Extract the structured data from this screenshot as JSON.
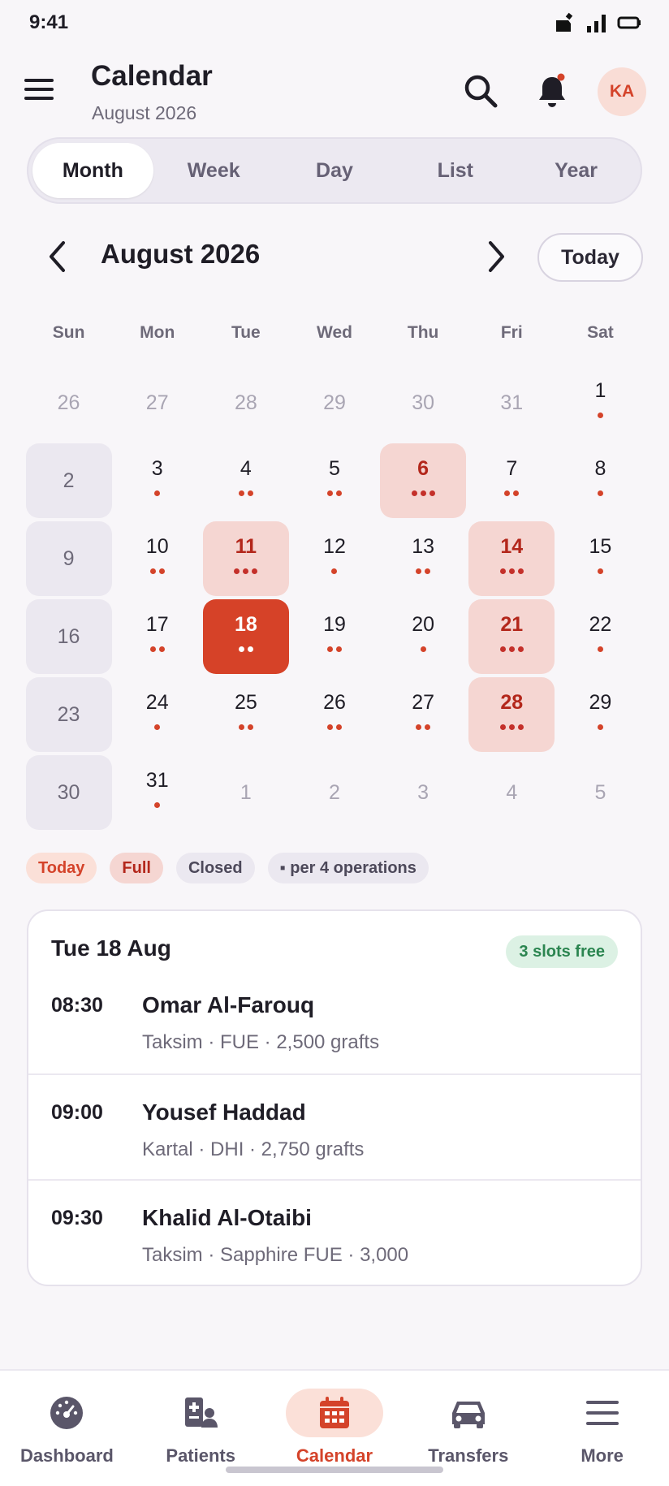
{
  "status_bar": {
    "time": "9:41"
  },
  "header": {
    "title": "Calendar",
    "subtitle": "August 2026",
    "avatar_initials": "KA"
  },
  "view_tabs": [
    {
      "label": "Month",
      "active": true
    },
    {
      "label": "Week",
      "active": false
    },
    {
      "label": "Day",
      "active": false
    },
    {
      "label": "List",
      "active": false
    },
    {
      "label": "Year",
      "active": false
    }
  ],
  "month_nav": {
    "title": "August 2026",
    "today_label": "Today"
  },
  "weekdays": [
    "Sun",
    "Mon",
    "Tue",
    "Wed",
    "Thu",
    "Fri",
    "Sat"
  ],
  "days": [
    {
      "n": "26",
      "state": "outside",
      "dots": 0
    },
    {
      "n": "27",
      "state": "outside",
      "dots": 0
    },
    {
      "n": "28",
      "state": "outside",
      "dots": 0
    },
    {
      "n": "29",
      "state": "outside",
      "dots": 0
    },
    {
      "n": "30",
      "state": "outside",
      "dots": 0
    },
    {
      "n": "31",
      "state": "outside",
      "dots": 0
    },
    {
      "n": "1",
      "state": "normal",
      "dots": 1
    },
    {
      "n": "2",
      "state": "closed",
      "dots": 0
    },
    {
      "n": "3",
      "state": "normal",
      "dots": 1
    },
    {
      "n": "4",
      "state": "normal",
      "dots": 2
    },
    {
      "n": "5",
      "state": "normal",
      "dots": 2
    },
    {
      "n": "6",
      "state": "full",
      "dots": 3
    },
    {
      "n": "7",
      "state": "normal",
      "dots": 2
    },
    {
      "n": "8",
      "state": "normal",
      "dots": 1
    },
    {
      "n": "9",
      "state": "closed",
      "dots": 0
    },
    {
      "n": "10",
      "state": "normal",
      "dots": 2
    },
    {
      "n": "11",
      "state": "full",
      "dots": 3
    },
    {
      "n": "12",
      "state": "normal",
      "dots": 1
    },
    {
      "n": "13",
      "state": "normal",
      "dots": 2
    },
    {
      "n": "14",
      "state": "full",
      "dots": 3
    },
    {
      "n": "15",
      "state": "normal",
      "dots": 1
    },
    {
      "n": "16",
      "state": "closed",
      "dots": 0
    },
    {
      "n": "17",
      "state": "normal",
      "dots": 2
    },
    {
      "n": "18",
      "state": "today",
      "dots": 2
    },
    {
      "n": "19",
      "state": "normal",
      "dots": 2
    },
    {
      "n": "20",
      "state": "normal",
      "dots": 1
    },
    {
      "n": "21",
      "state": "full",
      "dots": 3
    },
    {
      "n": "22",
      "state": "normal",
      "dots": 1
    },
    {
      "n": "23",
      "state": "closed",
      "dots": 0
    },
    {
      "n": "24",
      "state": "normal",
      "dots": 1
    },
    {
      "n": "25",
      "state": "normal",
      "dots": 2
    },
    {
      "n": "26",
      "state": "normal",
      "dots": 2
    },
    {
      "n": "27",
      "state": "normal",
      "dots": 2
    },
    {
      "n": "28",
      "state": "full",
      "dots": 3
    },
    {
      "n": "29",
      "state": "normal",
      "dots": 1
    },
    {
      "n": "30",
      "state": "closed",
      "dots": 0
    },
    {
      "n": "31",
      "state": "normal",
      "dots": 1
    },
    {
      "n": "1",
      "state": "outside",
      "dots": 0
    },
    {
      "n": "2",
      "state": "outside",
      "dots": 0
    },
    {
      "n": "3",
      "state": "outside",
      "dots": 0
    },
    {
      "n": "4",
      "state": "outside",
      "dots": 0
    },
    {
      "n": "5",
      "state": "outside",
      "dots": 0
    }
  ],
  "legend": {
    "today": "Today",
    "full": "Full",
    "closed": "Closed",
    "per": "▪ per 4 operations"
  },
  "day_panel": {
    "title": "Tue 18 Aug",
    "badge": "3 slots free",
    "appointments": [
      {
        "time": "08:30",
        "name": "Omar Al-Farouq",
        "detail": "Taksim · FUE · 2,500 grafts"
      },
      {
        "time": "09:00",
        "name": "Yousef Haddad",
        "detail": "Kartal · DHI · 2,750 grafts"
      },
      {
        "time": "09:30",
        "name": "Khalid Al-Otaibi",
        "detail": "Taksim · Sapphire FUE · 3,000"
      }
    ]
  },
  "bottom_nav": [
    {
      "label": "Dashboard",
      "icon": "dashboard-icon",
      "active": false
    },
    {
      "label": "Patients",
      "icon": "patients-icon",
      "active": false
    },
    {
      "label": "Calendar",
      "icon": "calendar-icon",
      "active": true
    },
    {
      "label": "Transfers",
      "icon": "car-icon",
      "active": false
    },
    {
      "label": "More",
      "icon": "menu-icon",
      "active": false
    }
  ],
  "colors": {
    "accent": "#d64228",
    "full_bg": "#f5d6d2",
    "closed_bg": "#ebe8f0",
    "success": "#2b8550"
  }
}
